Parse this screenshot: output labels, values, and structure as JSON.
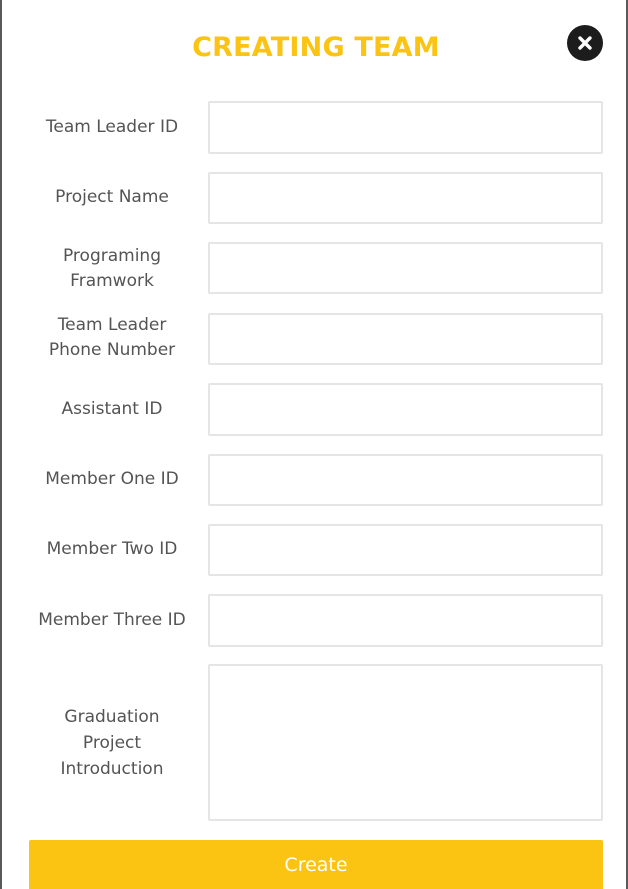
{
  "modal": {
    "title": "CREATING TEAM",
    "close_icon": "close-x-icon",
    "accent_color": "#fbc312"
  },
  "form": {
    "team_leader_id": {
      "label": "Team Leader ID",
      "value": ""
    },
    "project_name": {
      "label": "Project Name",
      "value": ""
    },
    "programing_framework": {
      "label_line1": "Programing",
      "label_line2": "Framwork",
      "value": ""
    },
    "team_leader_phone": {
      "label_line1": "Team Leader",
      "label_line2": "Phone Number",
      "value": ""
    },
    "assistant_id": {
      "label": "Assistant ID",
      "value": ""
    },
    "member_one_id": {
      "label": "Member One ID",
      "value": ""
    },
    "member_two_id": {
      "label": "Member Two ID",
      "value": ""
    },
    "member_three_id": {
      "label": "Member Three ID",
      "value": ""
    },
    "graduation_intro": {
      "label_line1": "Graduation",
      "label_line2": "Project",
      "label_line3": "Introduction",
      "value": ""
    }
  },
  "actions": {
    "create_label": "Create"
  }
}
